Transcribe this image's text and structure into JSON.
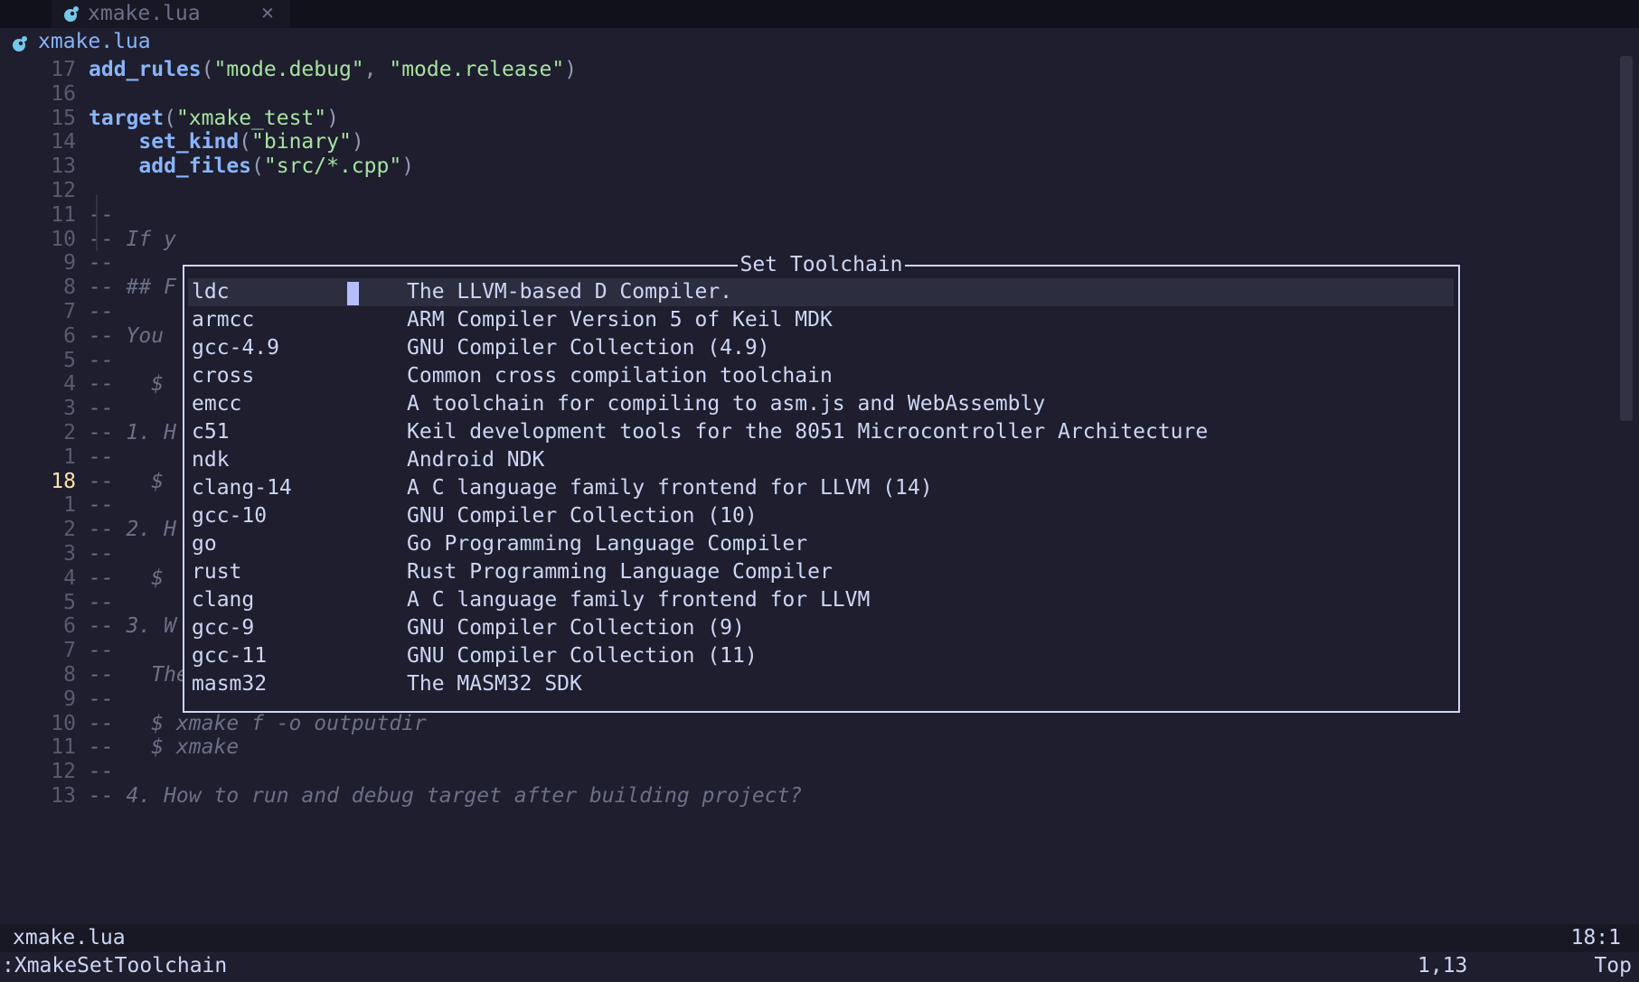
{
  "tabline": {
    "tab_label": "xmake.lua",
    "close_glyph": "✕",
    "icon": "lua-file-icon"
  },
  "winbar": {
    "label": "xmake.lua",
    "icon": "lua-file-icon"
  },
  "colors": {
    "background": "#1e1e2e",
    "function": "#89b4fa",
    "string": "#a6e3a1",
    "comment": "#6c7086",
    "cursor": "#b4befe"
  },
  "editor": {
    "lines": [
      {
        "num": "17",
        "segs": [
          [
            "fn",
            "add_rules"
          ],
          [
            "punc",
            "("
          ],
          [
            "str",
            "\"mode.debug\""
          ],
          [
            "punc",
            ", "
          ],
          [
            "str",
            "\"mode.release\""
          ],
          [
            "punc",
            ")"
          ]
        ]
      },
      {
        "num": "16",
        "segs": []
      },
      {
        "num": "15",
        "segs": [
          [
            "fn",
            "target"
          ],
          [
            "punc",
            "("
          ],
          [
            "str",
            "\"xmake_test\""
          ],
          [
            "punc",
            ")"
          ]
        ]
      },
      {
        "num": "14",
        "segs": [
          [
            "plain",
            "    "
          ],
          [
            "fn",
            "set_kind"
          ],
          [
            "punc",
            "("
          ],
          [
            "str",
            "\"binary\""
          ],
          [
            "punc",
            ")"
          ]
        ]
      },
      {
        "num": "13",
        "segs": [
          [
            "plain",
            "    "
          ],
          [
            "fn",
            "add_files"
          ],
          [
            "punc",
            "("
          ],
          [
            "str",
            "\"src/*.cpp\""
          ],
          [
            "punc",
            ")"
          ]
        ]
      },
      {
        "num": "12",
        "segs": []
      },
      {
        "num": "11",
        "segs": [
          [
            "cmt",
            "--"
          ]
        ]
      },
      {
        "num": "10",
        "segs": [
          [
            "cmt",
            "-- If y"
          ]
        ]
      },
      {
        "num": "9",
        "segs": [
          [
            "cmt",
            "--"
          ]
        ]
      },
      {
        "num": "8",
        "segs": [
          [
            "cmt",
            "-- ## F"
          ]
        ]
      },
      {
        "num": "7",
        "segs": [
          [
            "cmt",
            "--"
          ]
        ]
      },
      {
        "num": "6",
        "segs": [
          [
            "cmt",
            "-- You"
          ]
        ]
      },
      {
        "num": "5",
        "segs": [
          [
            "cmt",
            "--"
          ]
        ]
      },
      {
        "num": "4",
        "segs": [
          [
            "cmt",
            "--   $"
          ]
        ]
      },
      {
        "num": "3",
        "segs": [
          [
            "cmt",
            "--"
          ]
        ]
      },
      {
        "num": "2",
        "segs": [
          [
            "cmt",
            "-- 1. H"
          ]
        ]
      },
      {
        "num": "1",
        "segs": [
          [
            "cmt",
            "--"
          ]
        ]
      },
      {
        "num": "18",
        "current": true,
        "segs": [
          [
            "cmt",
            "--   $"
          ]
        ]
      },
      {
        "num": "1",
        "segs": [
          [
            "cmt",
            "--"
          ]
        ]
      },
      {
        "num": "2",
        "segs": [
          [
            "cmt",
            "-- 2. H"
          ]
        ]
      },
      {
        "num": "3",
        "segs": [
          [
            "cmt",
            "--"
          ]
        ]
      },
      {
        "num": "4",
        "segs": [
          [
            "cmt",
            "--   $"
          ]
        ]
      },
      {
        "num": "5",
        "segs": [
          [
            "cmt",
            "--"
          ]
        ]
      },
      {
        "num": "6",
        "segs": [
          [
            "cmt",
            "-- 3. W"
          ]
        ]
      },
      {
        "num": "7",
        "segs": [
          [
            "cmt",
            "--"
          ]
        ]
      },
      {
        "num": "8",
        "segs": [
          [
            "cmt",
            "--   The default output directory is `./build` and you can configure the output directory."
          ]
        ]
      },
      {
        "num": "9",
        "segs": [
          [
            "cmt",
            "--"
          ]
        ]
      },
      {
        "num": "10",
        "segs": [
          [
            "cmt",
            "--   $ xmake f -o outputdir"
          ]
        ]
      },
      {
        "num": "11",
        "segs": [
          [
            "cmt",
            "--   $ xmake"
          ]
        ]
      },
      {
        "num": "12",
        "segs": [
          [
            "cmt",
            "--"
          ]
        ]
      },
      {
        "num": "13",
        "segs": [
          [
            "cmt",
            "-- 4. How to run and debug target after building project?"
          ]
        ]
      }
    ]
  },
  "popup": {
    "title": "Set Toolchain",
    "items": [
      {
        "name": "ldc",
        "desc": "The LLVM-based D Compiler.",
        "selected": true
      },
      {
        "name": "armcc",
        "desc": "ARM Compiler Version 5 of Keil MDK"
      },
      {
        "name": "gcc-4.9",
        "desc": "GNU Compiler Collection (4.9)"
      },
      {
        "name": "cross",
        "desc": "Common cross compilation toolchain"
      },
      {
        "name": "emcc",
        "desc": "A toolchain for compiling to asm.js and WebAssembly"
      },
      {
        "name": "c51",
        "desc": "Keil development tools for the 8051 Microcontroller Architecture"
      },
      {
        "name": "ndk",
        "desc": "Android NDK"
      },
      {
        "name": "clang-14",
        "desc": "A C language family frontend for LLVM (14)"
      },
      {
        "name": "gcc-10",
        "desc": "GNU Compiler Collection (10)"
      },
      {
        "name": "go",
        "desc": "Go Programming Language Compiler"
      },
      {
        "name": "rust",
        "desc": "Rust Programming Language Compiler"
      },
      {
        "name": "clang",
        "desc": "A C language family frontend for LLVM"
      },
      {
        "name": "gcc-9",
        "desc": "GNU Compiler Collection (9)"
      },
      {
        "name": "gcc-11",
        "desc": "GNU Compiler Collection (11)"
      },
      {
        "name": "masm32",
        "desc": "The MASM32 SDK"
      }
    ]
  },
  "statusline": {
    "file": "xmake.lua",
    "position": "18:1"
  },
  "cmdline": {
    "command": ":XmakeSetToolchain",
    "cursor": "1,13",
    "scroll": "Top"
  }
}
